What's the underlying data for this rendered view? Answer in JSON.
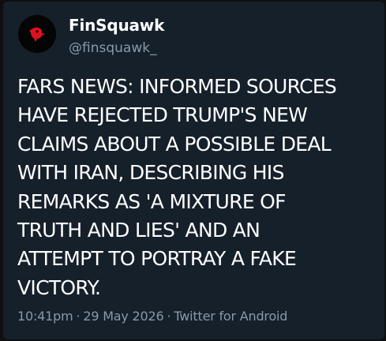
{
  "tweet": {
    "author": {
      "display_name": "FinSquawk",
      "handle": "@finsquawk_",
      "avatar_icon": "red-squawk-logo-icon"
    },
    "text": "FARS NEWS: INFORMED SOURCES\nHAVE REJECTED TRUMP'S NEW\nCLAIMS ABOUT A POSSIBLE DEAL\nWITH IRAN, DESCRIBING HIS\nREMARKS AS 'A MIXTURE OF\nTRUTH AND LIES' AND AN\nATTEMPT TO PORTRAY A FAKE\nVICTORY.",
    "time": "10:41pm",
    "date": "29 May 2026",
    "source": "Twitter for Android",
    "separator": "·"
  },
  "colors": {
    "background": "#15202b",
    "text": "#ffffff",
    "secondary": "#8b98a5",
    "logo_red": "#e0101e"
  }
}
